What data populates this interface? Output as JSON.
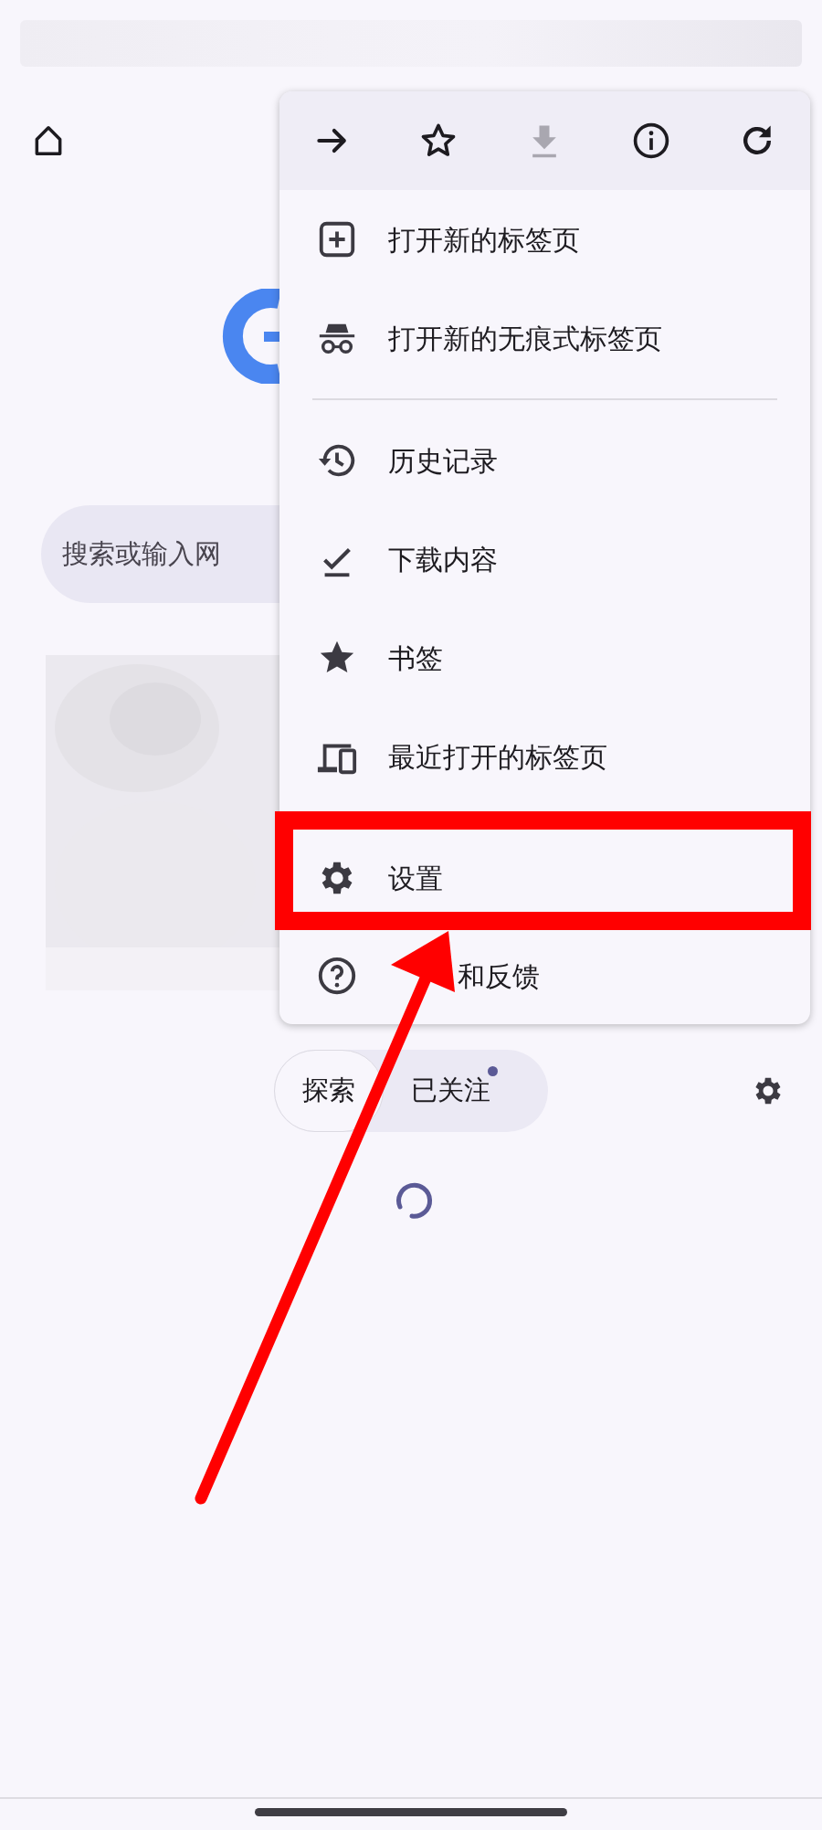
{
  "page": {
    "search": {
      "placeholder": "搜索或输入网"
    },
    "feed_tabs": [
      {
        "label": "探索",
        "selected": true,
        "dot": false
      },
      {
        "label": "已关注",
        "selected": false,
        "dot": true
      }
    ]
  },
  "menu": {
    "toolbar": [
      {
        "kind": "forward",
        "disabled": false
      },
      {
        "kind": "bookmark",
        "disabled": false
      },
      {
        "kind": "download",
        "disabled": true
      },
      {
        "kind": "info",
        "disabled": false
      },
      {
        "kind": "reload",
        "disabled": false
      }
    ],
    "items": [
      {
        "kind": "new-tab",
        "label": "打开新的标签页",
        "highlighted": false
      },
      {
        "kind": "incognito",
        "label": "打开新的无痕式标签页",
        "highlighted": false
      },
      {
        "kind": "divider"
      },
      {
        "kind": "history",
        "label": "历史记录",
        "highlighted": false
      },
      {
        "kind": "downloads",
        "label": "下载内容",
        "highlighted": false
      },
      {
        "kind": "bookmarks",
        "label": "书签",
        "highlighted": false
      },
      {
        "kind": "recent-tabs",
        "label": "最近打开的标签页",
        "highlighted": false
      },
      {
        "kind": "settings",
        "label": "设置",
        "highlighted": true
      },
      {
        "kind": "help",
        "label": "和反馈",
        "highlighted": false
      }
    ]
  }
}
